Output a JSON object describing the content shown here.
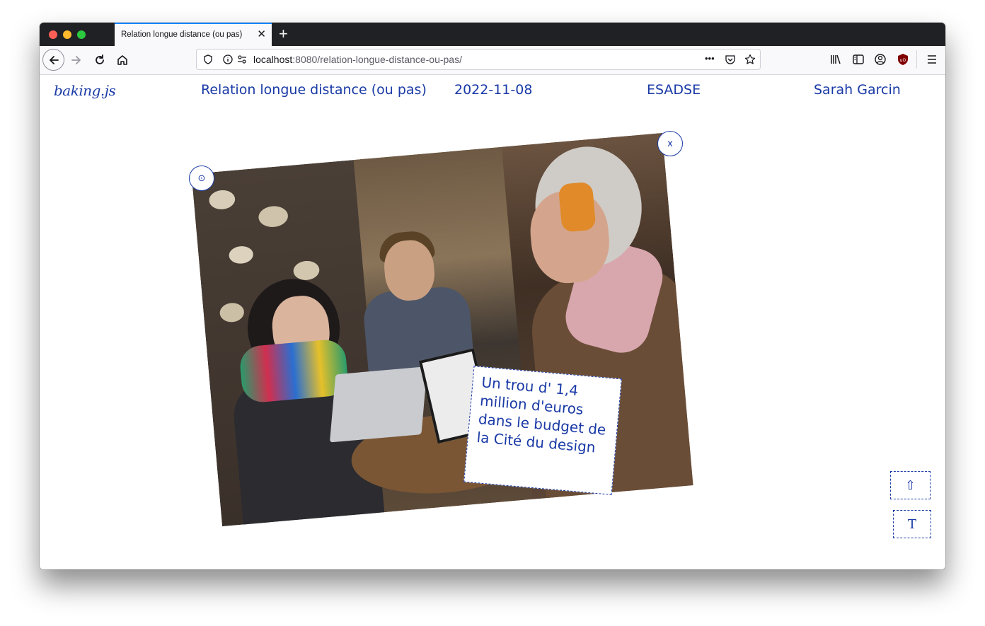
{
  "browser": {
    "tab_title": "Relation longue distance (ou pas)",
    "tab_close": "✕",
    "new_tab": "+",
    "url_host": "localhost",
    "url_rest": ":8080/relation-longue-distance-ou-pas/",
    "url_more": "•••"
  },
  "header": {
    "logo": "baking.js",
    "title": "Relation longue distance (ou pas)",
    "date": "2022-11-08",
    "school": "ESADSE",
    "author": "Sarah Garcin"
  },
  "card": {
    "caption": "Un trou d' 1,4 million d'euros dans le budget de la Cité du design",
    "close_label": "x",
    "rotate_handle": "⊙"
  },
  "tools": {
    "up_label": "⇧",
    "text_label": "T"
  },
  "colors": {
    "accent": "#1a3aa6"
  }
}
